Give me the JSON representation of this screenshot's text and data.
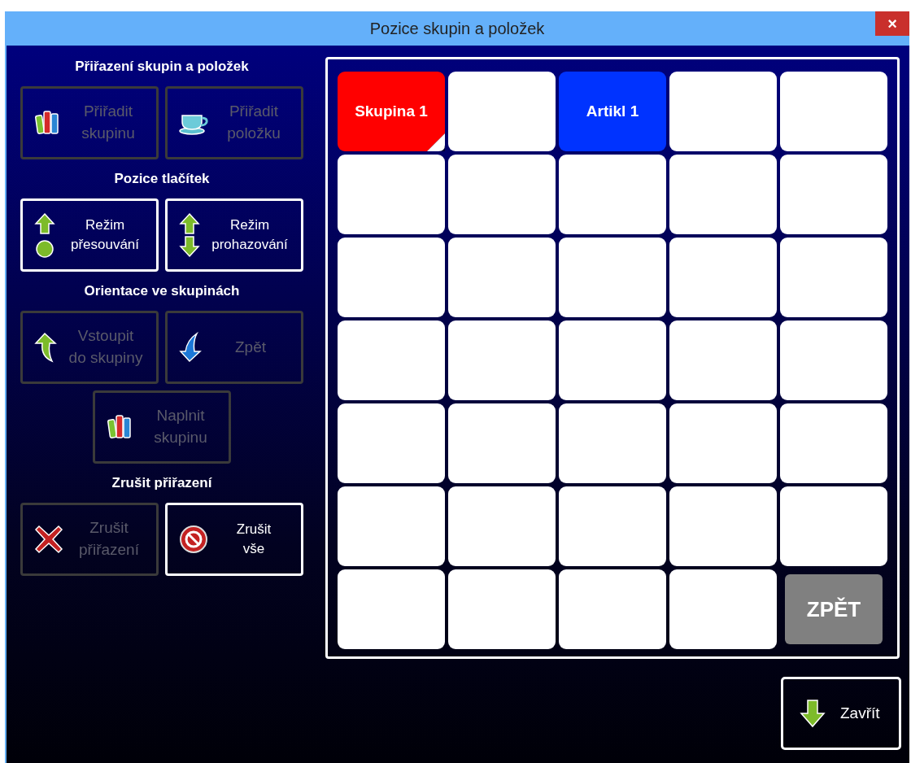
{
  "window": {
    "title": "Pozice skupin a položek",
    "close": "×"
  },
  "sections": [
    {
      "heading": "Přiřazení skupin a položek",
      "buttons": [
        {
          "kind": "books",
          "label": "Přiřadit\nskupinu",
          "disabled": true
        },
        {
          "kind": "cup",
          "label": "Přiřadit\npoložku",
          "disabled": true
        }
      ]
    },
    {
      "heading": "Pozice tlačítek",
      "buttons": [
        {
          "kind": "move",
          "label": "Režim\npřesouvání",
          "disabled": false
        },
        {
          "kind": "swap",
          "label": "Režim\nprohazování",
          "disabled": false
        }
      ]
    },
    {
      "heading": "Orientace ve skupinách",
      "buttons": [
        {
          "kind": "enter",
          "label": "Vstoupit\ndo skupiny",
          "disabled": true
        },
        {
          "kind": "back",
          "label": "Zpět",
          "disabled": true
        },
        {
          "kind": "books",
          "label": "Naplnit\nskupinu",
          "disabled": true
        }
      ]
    },
    {
      "heading": "Zrušit přiřazení",
      "buttons": [
        {
          "kind": "cross",
          "label": "Zrušit\npřiřazení",
          "disabled": true
        },
        {
          "kind": "forbid",
          "label": "Zrušit\nvše",
          "disabled": false
        }
      ]
    }
  ],
  "grid": {
    "cells": [
      {
        "kind": "group",
        "label": "Skupina 1",
        "color": "#ff0000"
      },
      {
        "kind": "empty"
      },
      {
        "kind": "item",
        "label": "Artikl 1",
        "color": "#0033ff"
      },
      {
        "kind": "empty"
      },
      {
        "kind": "empty"
      },
      {
        "kind": "empty"
      },
      {
        "kind": "empty"
      },
      {
        "kind": "empty"
      },
      {
        "kind": "empty"
      },
      {
        "kind": "empty"
      },
      {
        "kind": "empty"
      },
      {
        "kind": "empty"
      },
      {
        "kind": "empty"
      },
      {
        "kind": "empty"
      },
      {
        "kind": "empty"
      },
      {
        "kind": "empty"
      },
      {
        "kind": "empty"
      },
      {
        "kind": "empty"
      },
      {
        "kind": "empty"
      },
      {
        "kind": "empty"
      },
      {
        "kind": "empty"
      },
      {
        "kind": "empty"
      },
      {
        "kind": "empty"
      },
      {
        "kind": "empty"
      },
      {
        "kind": "empty"
      },
      {
        "kind": "empty"
      },
      {
        "kind": "empty"
      },
      {
        "kind": "empty"
      },
      {
        "kind": "empty"
      },
      {
        "kind": "empty"
      },
      {
        "kind": "empty"
      },
      {
        "kind": "empty"
      },
      {
        "kind": "empty"
      },
      {
        "kind": "empty"
      },
      {
        "kind": "back",
        "label": "ZPĚT"
      }
    ]
  },
  "close_button": {
    "kind": "down",
    "label": "Zavřít"
  }
}
